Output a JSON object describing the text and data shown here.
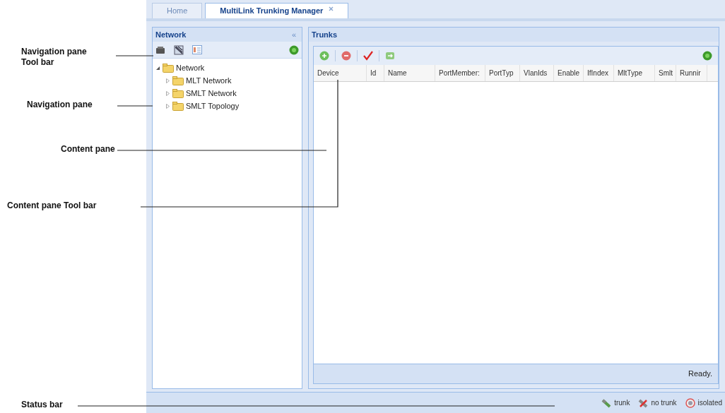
{
  "tabs": [
    {
      "label": "Home",
      "selected": false,
      "closable": false
    },
    {
      "label": "MultiLink Trunking Manager",
      "selected": true,
      "closable": true
    }
  ],
  "navigation": {
    "title": "Network",
    "collapse_glyph": "«",
    "tree": [
      {
        "label": "Network",
        "expanded": true,
        "children": [
          {
            "label": "MLT Network",
            "expanded": false
          },
          {
            "label": "SMLT Network",
            "expanded": false
          },
          {
            "label": "SMLT Topology",
            "expanded": false
          }
        ]
      }
    ]
  },
  "content": {
    "title": "Trunks",
    "toolbar": [
      {
        "kind": "add"
      },
      {
        "kind": "remove"
      },
      {
        "kind": "apply"
      },
      {
        "kind": "refresh"
      }
    ],
    "table": {
      "columns": [
        "Device",
        "Id",
        "Name",
        "PortMember:",
        "PortTyp",
        "VlanIds",
        "Enable",
        "IfIndex",
        "MltType",
        "Smlt",
        "Runnir"
      ]
    },
    "status": "Ready."
  },
  "status_bar": {
    "legend": [
      {
        "kind": "trunk",
        "label": "trunk"
      },
      {
        "kind": "no_trunk",
        "label": "no trunk"
      },
      {
        "kind": "isolated",
        "label": "isolated"
      }
    ]
  },
  "callouts": [
    "Navigation pane\nTool bar",
    "Navigation pane",
    "Content pane",
    "Content pane Tool bar",
    "Status bar"
  ]
}
